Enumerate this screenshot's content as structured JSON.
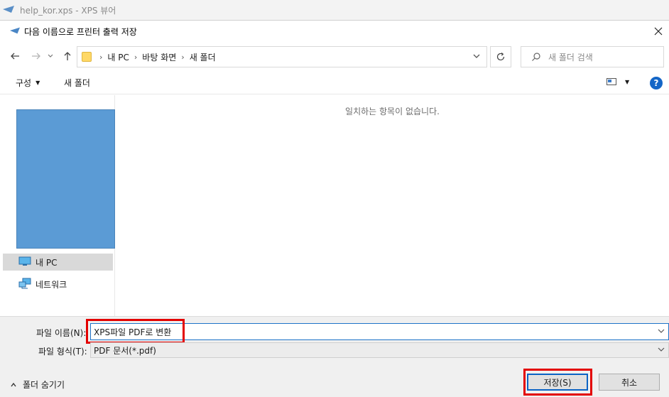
{
  "background_window": {
    "title": "help_kor.xps - XPS 뷰어",
    "icon": "xps-viewer-icon"
  },
  "dialog": {
    "title": "다음 이름으로 프린터 출력 저장",
    "icon": "xps-viewer-icon"
  },
  "navigation": {
    "breadcrumb": [
      "내 PC",
      "바탕 화면",
      "새 폴더"
    ],
    "search_placeholder": "새 폴더 검색"
  },
  "toolbar": {
    "organize_label": "구성",
    "new_folder_label": "새 폴더"
  },
  "nav_pane": {
    "items": [
      {
        "label": "내 PC",
        "icon": "computer-icon",
        "selected": true
      },
      {
        "label": "네트워크",
        "icon": "network-icon",
        "selected": false
      }
    ]
  },
  "content": {
    "empty_message": "일치하는 항목이 없습니다."
  },
  "form": {
    "filename_label": "파일 이름(N):",
    "filename_value": "XPS파일 PDF로 변환",
    "filetype_label": "파일 형식(T):",
    "filetype_value": "PDF 문서(*.pdf)"
  },
  "footer": {
    "hide_folders_label": "폴더 숨기기",
    "save_label": "저장(S)",
    "cancel_label": "취소"
  },
  "colors": {
    "highlight": "#e30000",
    "accent": "#1e73c8",
    "preview": "#5b9bd5"
  }
}
